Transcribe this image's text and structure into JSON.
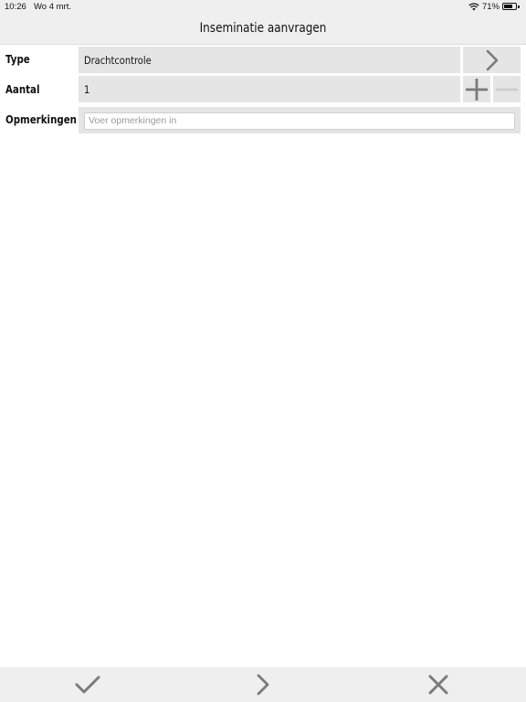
{
  "status_bar": {
    "time": "10:26",
    "date": "Wo 4 mrt.",
    "battery_percent": "71%",
    "battery_level": 0.71,
    "wifi_icon": "wifi-icon",
    "battery_icon": "battery-icon"
  },
  "nav": {
    "title": "Inseminatie aanvragen"
  },
  "form": {
    "type": {
      "label": "Type",
      "value": "Drachtcontrole",
      "action_icon": "chevron-right-icon"
    },
    "aantal": {
      "label": "Aantal",
      "value": "1",
      "increment_icon": "plus-icon",
      "decrement_icon": "minus-icon"
    },
    "opmerkingen": {
      "label": "Opmerkingen",
      "value": "",
      "placeholder": "Voer opmerkingen in"
    }
  },
  "toolbar": {
    "confirm_icon": "checkmark-icon",
    "next_icon": "chevron-right-icon",
    "cancel_icon": "close-icon"
  },
  "colors": {
    "bar_background": "#efefef",
    "field_background": "#e5e5e5",
    "icon_gray": "#7a7a7a"
  }
}
